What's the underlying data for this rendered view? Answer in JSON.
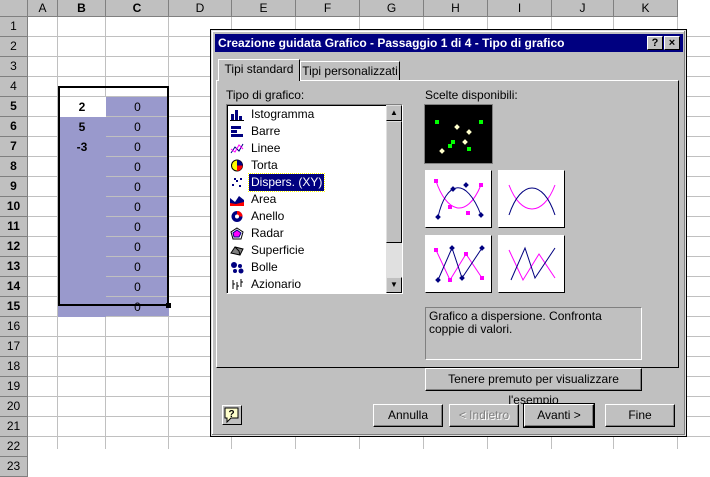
{
  "spreadsheet": {
    "columns": [
      "A",
      "B",
      "C",
      "D",
      "E",
      "F",
      "G",
      "H",
      "I",
      "J",
      "K"
    ],
    "rows": [
      "1",
      "2",
      "3",
      "4",
      "5",
      "6",
      "7",
      "8",
      "9",
      "10",
      "11",
      "12",
      "13",
      "14",
      "15",
      "16",
      "17",
      "18",
      "19",
      "20",
      "21",
      "22",
      "23"
    ],
    "column_b_values": [
      "2",
      "5",
      "-3",
      "",
      "",
      "",
      "",
      "",
      "",
      "",
      ""
    ],
    "column_c_values": [
      "0",
      "0",
      "0",
      "0",
      "0",
      "0",
      "0",
      "0",
      "0",
      "0",
      "0"
    ],
    "selection_color": "#9999cc"
  },
  "dialog": {
    "title": "Creazione guidata Grafico - Passaggio 1 di 4 - Tipo di grafico",
    "title_buttons": {
      "help": "?",
      "close": "×"
    },
    "tabs": [
      "Tipi standard",
      "Tipi personalizzati"
    ],
    "chart_type_label": "Tipo di grafico:",
    "subtypes_label": "Scelte disponibili:",
    "chart_types": [
      {
        "label": "Istogramma",
        "icon": "column-chart-icon"
      },
      {
        "label": "Barre",
        "icon": "bar-chart-icon"
      },
      {
        "label": "Linee",
        "icon": "line-chart-icon"
      },
      {
        "label": "Torta",
        "icon": "pie-chart-icon"
      },
      {
        "label": "Dispers. (XY)",
        "icon": "scatter-chart-icon"
      },
      {
        "label": "Area",
        "icon": "area-chart-icon"
      },
      {
        "label": "Anello",
        "icon": "doughnut-chart-icon"
      },
      {
        "label": "Radar",
        "icon": "radar-chart-icon"
      },
      {
        "label": "Superficie",
        "icon": "surface-chart-icon"
      },
      {
        "label": "Bolle",
        "icon": "bubble-chart-icon"
      },
      {
        "label": "Azionario",
        "icon": "stock-chart-icon"
      }
    ],
    "selected_chart_type": "Dispers. (XY)",
    "description": "Grafico a dispersione. Confronta coppie di valori.",
    "preview_button": "Tenere premuto per visualizzare l'esempio",
    "help_icon": "question-help-icon",
    "buttons": {
      "cancel": "Annulla",
      "back": "< Indietro",
      "next": "Avanti >",
      "finish": "Fine"
    },
    "title_bar_color": "#000080"
  }
}
